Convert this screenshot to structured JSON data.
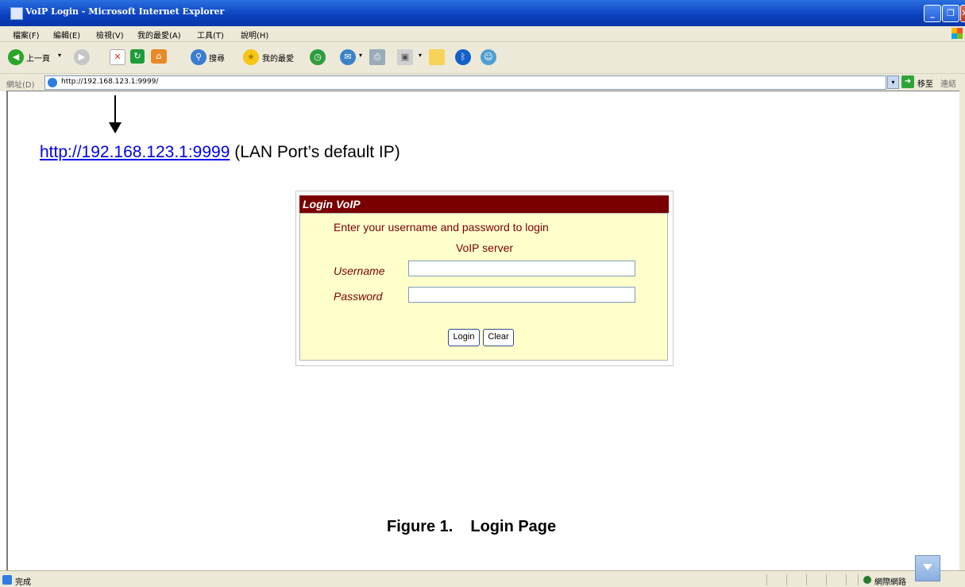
{
  "window": {
    "title": "VoIP Login - Microsoft Internet Explorer",
    "min_symbol": "_",
    "max_symbol": "❐",
    "close_symbol": "✕"
  },
  "menu": {
    "file": "檔案(F)",
    "edit": "編輯(E)",
    "view": "檢視(V)",
    "favorites": "我的最愛(A)",
    "tools": "工具(T)",
    "help": "說明(H)"
  },
  "toolbar": {
    "back_label": "上一頁",
    "search_label": "搜尋",
    "favorites_label": "我的最愛",
    "dropdown_symbol": "▾"
  },
  "address": {
    "label": "網址(D)",
    "url": "http://192.168.123.1:9999/",
    "go_label": "移至",
    "links_label": "連結"
  },
  "annotation": {
    "link_text": "http://192.168.123.1:9999",
    "note": " (LAN Port’s default IP)"
  },
  "login": {
    "header": "Login VoIP",
    "prompt_line1": "Enter your username and password to login",
    "prompt_line2": "VoIP server",
    "username_label": "Username",
    "password_label": "Password",
    "username_value": "",
    "password_value": "",
    "login_button": "Login",
    "clear_button": "Clear"
  },
  "caption": {
    "number": "Figure 1.",
    "title": "Login Page"
  },
  "status": {
    "text": "完成",
    "zone": "網際網路"
  },
  "colors": {
    "header_bg": "#7a0000",
    "form_bg": "#ffffcc",
    "link": "#0000ee",
    "chrome": "#ece9d8",
    "titlebar": "#0a3fbd"
  }
}
